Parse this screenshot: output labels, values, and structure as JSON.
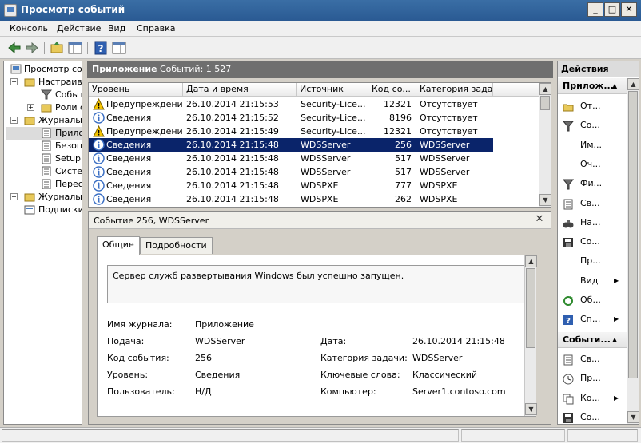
{
  "window": {
    "title": "Просмотр событий"
  },
  "menu": [
    "Консоль",
    "Действие",
    "Вид",
    "Справка"
  ],
  "tree": [
    {
      "label": "Просмотр событ",
      "expander": ""
    },
    {
      "label": "Настраива",
      "expander": "−"
    },
    {
      "label": "Событ",
      "expander": ""
    },
    {
      "label": "Роли се",
      "expander": "+"
    },
    {
      "label": "Журналы W",
      "expander": "−"
    },
    {
      "label": "Прилож",
      "expander": ""
    },
    {
      "label": "Безопа",
      "expander": ""
    },
    {
      "label": "Setup",
      "expander": ""
    },
    {
      "label": "Систем",
      "expander": ""
    },
    {
      "label": "Пересл",
      "expander": ""
    },
    {
      "label": "Журналы п",
      "expander": "+"
    },
    {
      "label": "Подписки",
      "expander": ""
    }
  ],
  "center": {
    "title": "Приложение",
    "count": "Событий: 1 527",
    "columns": [
      "Уровень",
      "Дата и время",
      "Источник",
      "Код со...",
      "Категория зада..."
    ],
    "rows": [
      {
        "level": "Предупреждение",
        "type": "warning",
        "date": "26.10.2014 21:15:53",
        "source": "Security-Lice...",
        "code": "12321",
        "category": "Отсутствует",
        "selected": false
      },
      {
        "level": "Сведения",
        "type": "info",
        "date": "26.10.2014 21:15:52",
        "source": "Security-Lice...",
        "code": "8196",
        "category": "Отсутствует",
        "selected": false
      },
      {
        "level": "Предупреждение",
        "type": "warning",
        "date": "26.10.2014 21:15:49",
        "source": "Security-Lice...",
        "code": "12321",
        "category": "Отсутствует",
        "selected": false
      },
      {
        "level": "Сведения",
        "type": "info",
        "date": "26.10.2014 21:15:48",
        "source": "WDSServer",
        "code": "256",
        "category": "WDSServer",
        "selected": true
      },
      {
        "level": "Сведения",
        "type": "info",
        "date": "26.10.2014 21:15:48",
        "source": "WDSServer",
        "code": "517",
        "category": "WDSServer",
        "selected": false
      },
      {
        "level": "Сведения",
        "type": "info",
        "date": "26.10.2014 21:15:48",
        "source": "WDSServer",
        "code": "517",
        "category": "WDSServer",
        "selected": false
      },
      {
        "level": "Сведения",
        "type": "info",
        "date": "26.10.2014 21:15:48",
        "source": "WDSPXE",
        "code": "777",
        "category": "WDSPXE",
        "selected": false
      },
      {
        "level": "Сведения",
        "type": "info",
        "date": "26.10.2014 21:15:48",
        "source": "WDSPXE",
        "code": "262",
        "category": "WDSPXE",
        "selected": false
      }
    ]
  },
  "detail": {
    "title": "Событие 256, WDSServer",
    "tabs": [
      "Общие",
      "Подробности"
    ],
    "description": "Сервер служб развертывания Windows был успешно запущен.",
    "fields": {
      "log_label": "Имя журнала:",
      "log_value": "Приложение",
      "source_label": "Подача:",
      "source_value": "WDSServer",
      "date_label": "Дата:",
      "date_value": "26.10.2014 21:15:48",
      "code_label": "Код события:",
      "code_value": "256",
      "task_label": "Категория задачи:",
      "task_value": "WDSServer",
      "level_label": "Уровень:",
      "level_value": "Сведения",
      "keywords_label": "Ключевые слова:",
      "keywords_value": "Классический",
      "user_label": "Пользователь:",
      "user_value": "Н/Д",
      "computer_label": "Компьютер:",
      "computer_value": "Server1.contoso.com"
    }
  },
  "actions": {
    "header": "Действия",
    "section1": "Прилож...",
    "items1": [
      {
        "label": "От...",
        "icon": "open-folder-icon",
        "arrow": false
      },
      {
        "label": "Со...",
        "icon": "filter-icon",
        "arrow": false
      },
      {
        "label": "Им...",
        "icon": "blank-icon",
        "arrow": false
      },
      {
        "label": "Оч...",
        "icon": "blank-icon",
        "arrow": false
      },
      {
        "label": "Фи...",
        "icon": "filter-icon",
        "arrow": false
      },
      {
        "label": "Св...",
        "icon": "properties-icon",
        "arrow": false
      },
      {
        "label": "На...",
        "icon": "binoculars-icon",
        "arrow": false
      },
      {
        "label": "Со...",
        "icon": "save-icon",
        "arrow": false
      },
      {
        "label": "Пр...",
        "icon": "blank-icon",
        "arrow": false
      },
      {
        "label": "Вид",
        "icon": "blank-icon",
        "arrow": true
      },
      {
        "label": "Об...",
        "icon": "refresh-icon",
        "arrow": false
      },
      {
        "label": "Сп...",
        "icon": "help-icon",
        "arrow": true
      }
    ],
    "section2": "Событи...",
    "items2": [
      {
        "label": "Св...",
        "icon": "properties-icon",
        "arrow": false
      },
      {
        "label": "Пр...",
        "icon": "clock-icon",
        "arrow": false
      },
      {
        "label": "Ко...",
        "icon": "copy-icon",
        "arrow": true
      },
      {
        "label": "Со...",
        "icon": "save-icon",
        "arrow": false
      }
    ]
  },
  "colors": {
    "selection": "#0a246a",
    "title_bar": "#2a5a93",
    "warning": "#f5c400",
    "info": "#3b6fc4"
  }
}
